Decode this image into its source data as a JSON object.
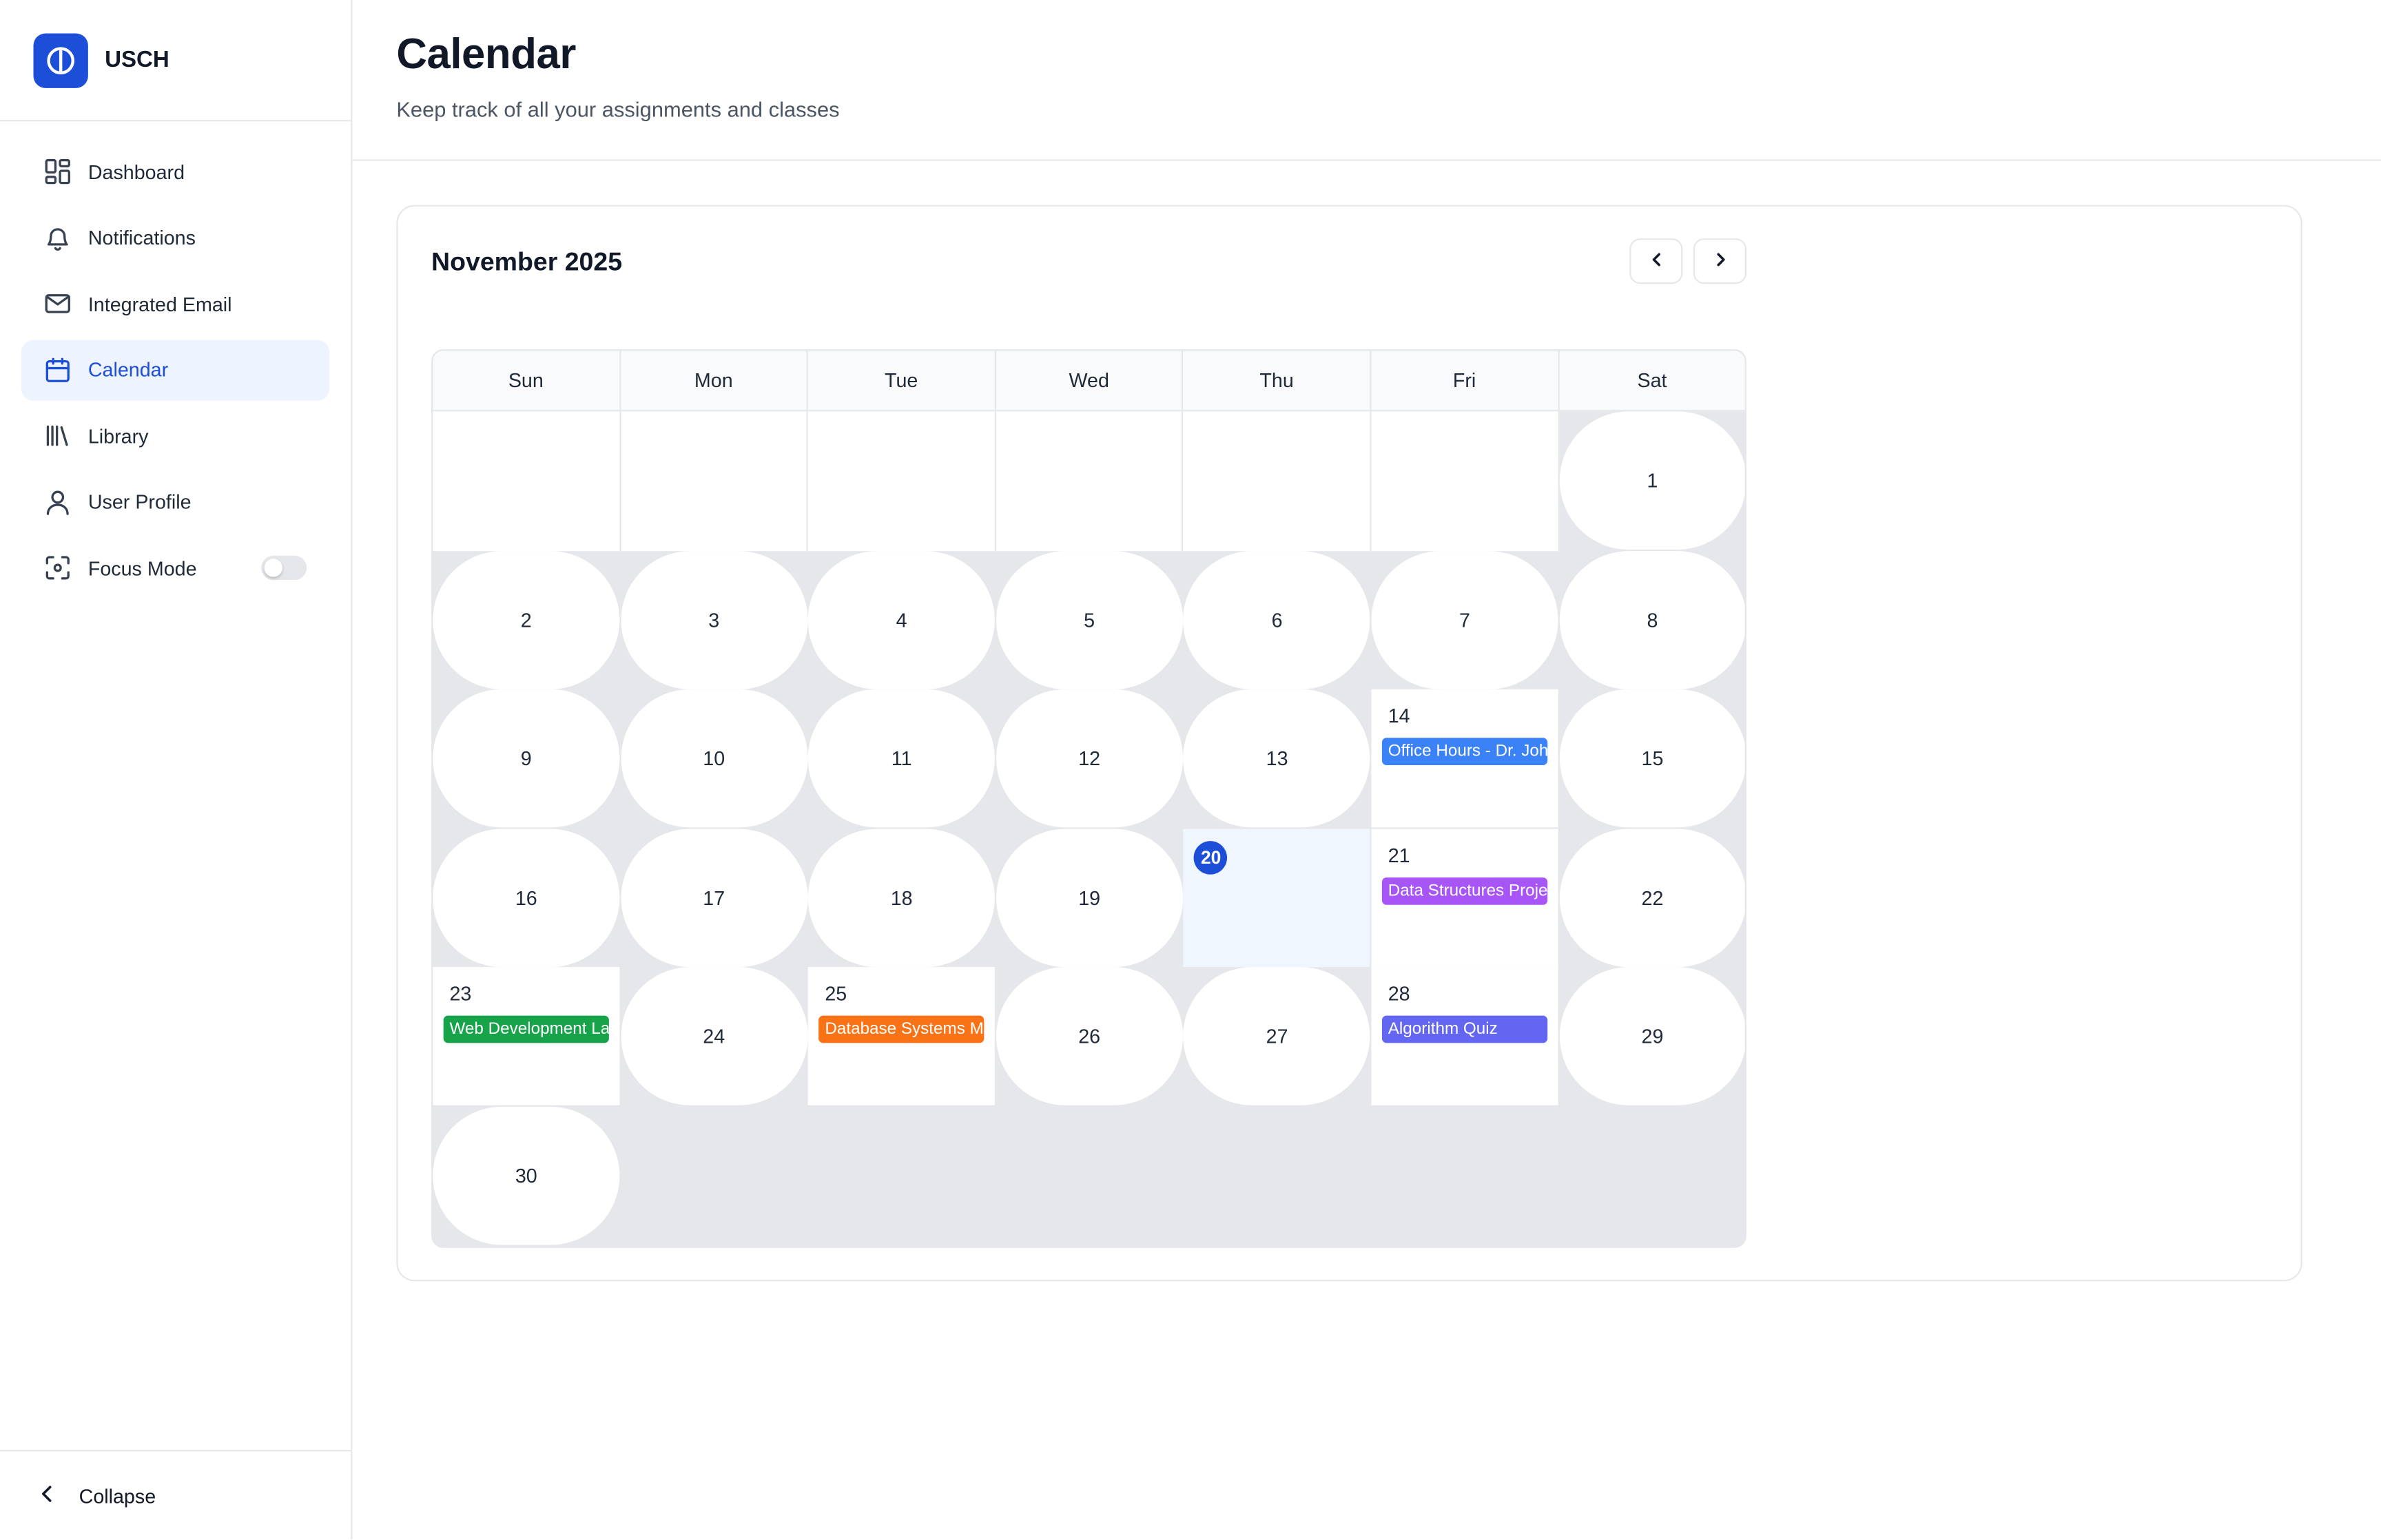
{
  "brand": {
    "name": "USCH"
  },
  "sidebar": {
    "items": [
      {
        "key": "dashboard",
        "label": "Dashboard",
        "icon": "dashboard-icon",
        "active": false
      },
      {
        "key": "notifications",
        "label": "Notifications",
        "icon": "bell-icon",
        "active": false
      },
      {
        "key": "email",
        "label": "Integrated Email",
        "icon": "mail-icon",
        "active": false
      },
      {
        "key": "calendar",
        "label": "Calendar",
        "icon": "calendar-icon",
        "active": true
      },
      {
        "key": "library",
        "label": "Library",
        "icon": "library-icon",
        "active": false
      },
      {
        "key": "profile",
        "label": "User Profile",
        "icon": "user-icon",
        "active": false
      },
      {
        "key": "focus",
        "label": "Focus Mode",
        "icon": "focus-icon",
        "active": false,
        "toggle": false
      }
    ],
    "collapse_label": "Collapse"
  },
  "header": {
    "title": "Calendar",
    "subtitle": "Keep track of all your assignments and classes"
  },
  "calendar": {
    "month_label": "November 2025",
    "weekdays": [
      "Sun",
      "Mon",
      "Tue",
      "Wed",
      "Thu",
      "Fri",
      "Sat"
    ],
    "first_weekday_index": 6,
    "days_in_month": 30,
    "today": 20,
    "events": [
      {
        "day": 14,
        "title": "Office Hours - Dr. Johnson",
        "color": "#3b82f6"
      },
      {
        "day": 21,
        "title": "Data Structures Project",
        "color": "#a855f7"
      },
      {
        "day": 23,
        "title": "Web Development Lab",
        "color": "#16a34a"
      },
      {
        "day": 25,
        "title": "Database Systems Midterm",
        "color": "#f97316"
      },
      {
        "day": 28,
        "title": "Algorithm Quiz",
        "color": "#6366f1"
      }
    ]
  },
  "colors": {
    "accent": "#1d4ed8",
    "active_nav_bg": "#eef4ff",
    "today_bg": "#eff6ff"
  }
}
